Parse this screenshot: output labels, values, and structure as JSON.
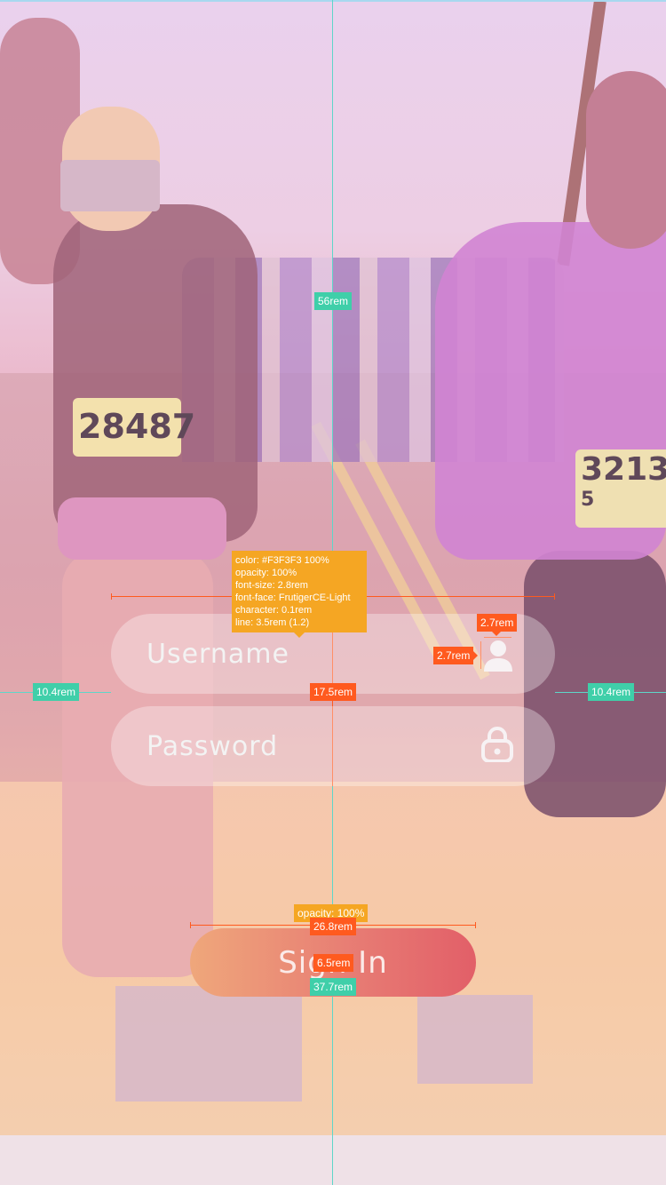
{
  "form": {
    "username_placeholder": "Username",
    "password_placeholder": "Password",
    "sign_in_label": "Sign In",
    "username_icon": "person-icon",
    "password_icon": "lock-icon"
  },
  "bibs": {
    "left_number": "28487",
    "right_number": "3213",
    "right_sub": "5"
  },
  "annotations": {
    "top_offset": "56rem",
    "left_margin": "10.4rem",
    "right_margin": "10.4rem",
    "field_gap": "17.5rem",
    "icon_width": "2.7rem",
    "icon_height": "2.7rem",
    "button_width": "26.8rem",
    "button_height": "6.5rem",
    "button_bottom": "37.7rem",
    "button_opacity": "opacity: 100%",
    "text_spec": [
      "color: #F3F3F3 100%",
      "opacity: 100%",
      "font-size: 2.8rem",
      "font-face: FrutigerCE-Light",
      "character: 0.1rem",
      "line: 3.5rem (1.2)"
    ]
  },
  "colors": {
    "text": "#F3F3F3",
    "button_start": "#EFA77B",
    "button_end": "#E25F68",
    "guide_teal": "#5ED6C9",
    "guide_orange": "#FF5A1F",
    "spec_amber": "#F5A623"
  }
}
